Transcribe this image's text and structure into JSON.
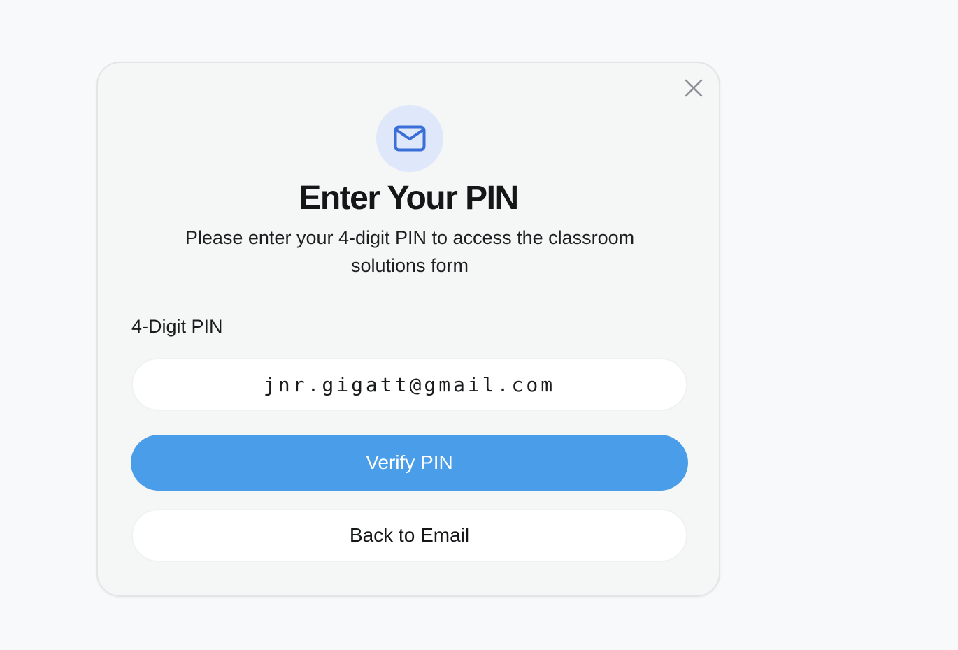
{
  "dialog": {
    "title": "Enter Your PIN",
    "subtitle": "Please enter your 4-digit PIN to access the classroom solutions form",
    "header_icon": "mail-icon",
    "close_icon": "close-icon"
  },
  "pin_field": {
    "label": "4-Digit PIN",
    "value": "jnr.gigatt@gmail.com"
  },
  "buttons": {
    "verify_label": "Verify PIN",
    "back_label": "Back to Email"
  },
  "colors": {
    "primary": "#4a9de9",
    "icon_accent": "#3a6fd8",
    "icon_bg": "#dfe8fa",
    "close_icon": "#8a8f98"
  }
}
